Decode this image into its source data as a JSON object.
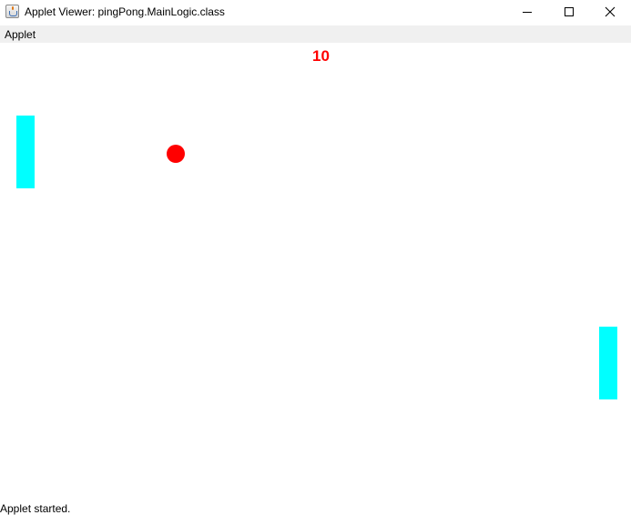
{
  "window": {
    "title": "Applet Viewer: pingPong.MainLogic.class",
    "icon": "java-icon"
  },
  "menubar": {
    "items": [
      {
        "label": "Applet"
      }
    ]
  },
  "game": {
    "score": "10",
    "colors": {
      "score": "#ff0000",
      "ball": "#ff0000",
      "paddle": "#00ffff",
      "background": "#ffffff"
    }
  },
  "statusbar": {
    "text": "Applet started."
  }
}
